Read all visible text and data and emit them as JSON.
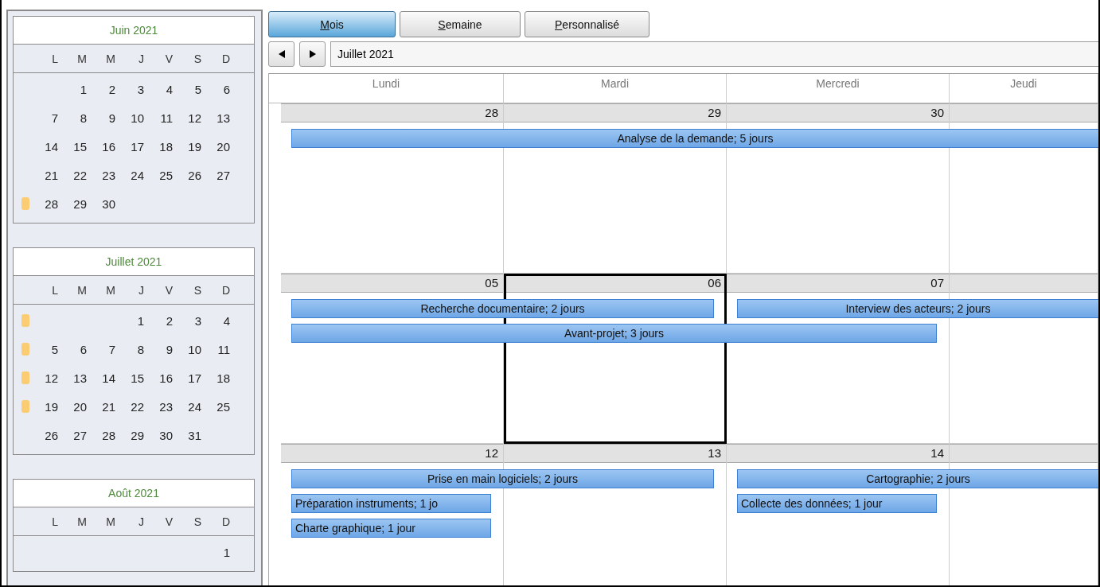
{
  "mini_calendars": [
    {
      "title": "Juin 2021",
      "weekdays": [
        "L",
        "M",
        "M",
        "J",
        "V",
        "S",
        "D"
      ],
      "weeks": [
        {
          "marked": false,
          "days": [
            "1",
            "2",
            "3",
            "4",
            "5",
            "6"
          ]
        },
        {
          "marked": false,
          "days": [
            "7",
            "8",
            "9",
            "10",
            "11",
            "12",
            "13"
          ]
        },
        {
          "marked": false,
          "days": [
            "14",
            "15",
            "16",
            "17",
            "18",
            "19",
            "20"
          ]
        },
        {
          "marked": false,
          "days": [
            "21",
            "22",
            "23",
            "24",
            "25",
            "26",
            "27"
          ]
        },
        {
          "marked": true,
          "days": [
            "28",
            "29",
            "30"
          ]
        }
      ]
    },
    {
      "title": "Juillet 2021",
      "weekdays": [
        "L",
        "M",
        "M",
        "J",
        "V",
        "S",
        "D"
      ],
      "weeks": [
        {
          "marked": true,
          "days": [
            "1",
            "2",
            "3",
            "4"
          ]
        },
        {
          "marked": true,
          "days": [
            "5",
            "6",
            "7",
            "8",
            "9",
            "10",
            "11"
          ]
        },
        {
          "marked": true,
          "days": [
            "12",
            "13",
            "14",
            "15",
            "16",
            "17",
            "18"
          ]
        },
        {
          "marked": true,
          "days": [
            "19",
            "20",
            "21",
            "22",
            "23",
            "24",
            "25"
          ]
        },
        {
          "marked": false,
          "days": [
            "26",
            "27",
            "28",
            "29",
            "30",
            "31"
          ]
        }
      ]
    },
    {
      "title": "Août 2021",
      "weekdays": [
        "L",
        "M",
        "M",
        "J",
        "V",
        "S",
        "D"
      ],
      "weeks": [
        {
          "marked": false,
          "days": [
            "1"
          ]
        }
      ]
    }
  ],
  "view_tabs": [
    {
      "label": "Mois",
      "selected": true
    },
    {
      "label": "Semaine",
      "selected": false
    },
    {
      "label": "Personnalisé",
      "selected": false
    }
  ],
  "period": "Juillet 2021",
  "weekdays": [
    "Lundi",
    "Mardi",
    "Mercredi",
    "Jeudi"
  ],
  "weeks": [
    {
      "days": [
        {
          "date": "28",
          "selected": false
        },
        {
          "date": "29",
          "selected": false
        },
        {
          "date": "30",
          "selected": false
        },
        {
          "selected": false
        }
      ],
      "lanes": [
        [
          {
            "kind": "to-edge",
            "label": "Analyse de la demande; 5 jours"
          }
        ]
      ]
    },
    {
      "days": [
        {
          "date": "05",
          "selected": false
        },
        {
          "date": "06",
          "selected": true
        },
        {
          "date": "07",
          "selected": false
        },
        {
          "selected": false
        }
      ],
      "lanes": [
        [
          {
            "kind": "two-day",
            "label": "Recherche documentaire; 2 jours"
          },
          {
            "kind": "to-edge",
            "label": "Interview des acteurs; 2 jours"
          }
        ],
        [
          {
            "kind": "three-day",
            "label": "Avant-projet; 3 jours"
          }
        ]
      ]
    },
    {
      "days": [
        {
          "date": "12",
          "selected": false
        },
        {
          "date": "13",
          "selected": false
        },
        {
          "date": "14",
          "selected": false
        },
        {
          "selected": false
        }
      ],
      "lanes": [
        [
          {
            "kind": "two-day",
            "label": "Prise en main logiciels; 2 jours"
          },
          {
            "kind": "to-edge",
            "label": "Cartographie; 2 jours"
          }
        ],
        [
          {
            "kind": "one-day",
            "label": "Préparation instruments; 1 jo"
          },
          {
            "kind": "gap"
          },
          {
            "kind": "one-day",
            "label": "Collecte des données; 1 jour"
          }
        ],
        [
          {
            "kind": "one-day",
            "label": "Charte graphique; 1 jour"
          }
        ]
      ]
    }
  ]
}
